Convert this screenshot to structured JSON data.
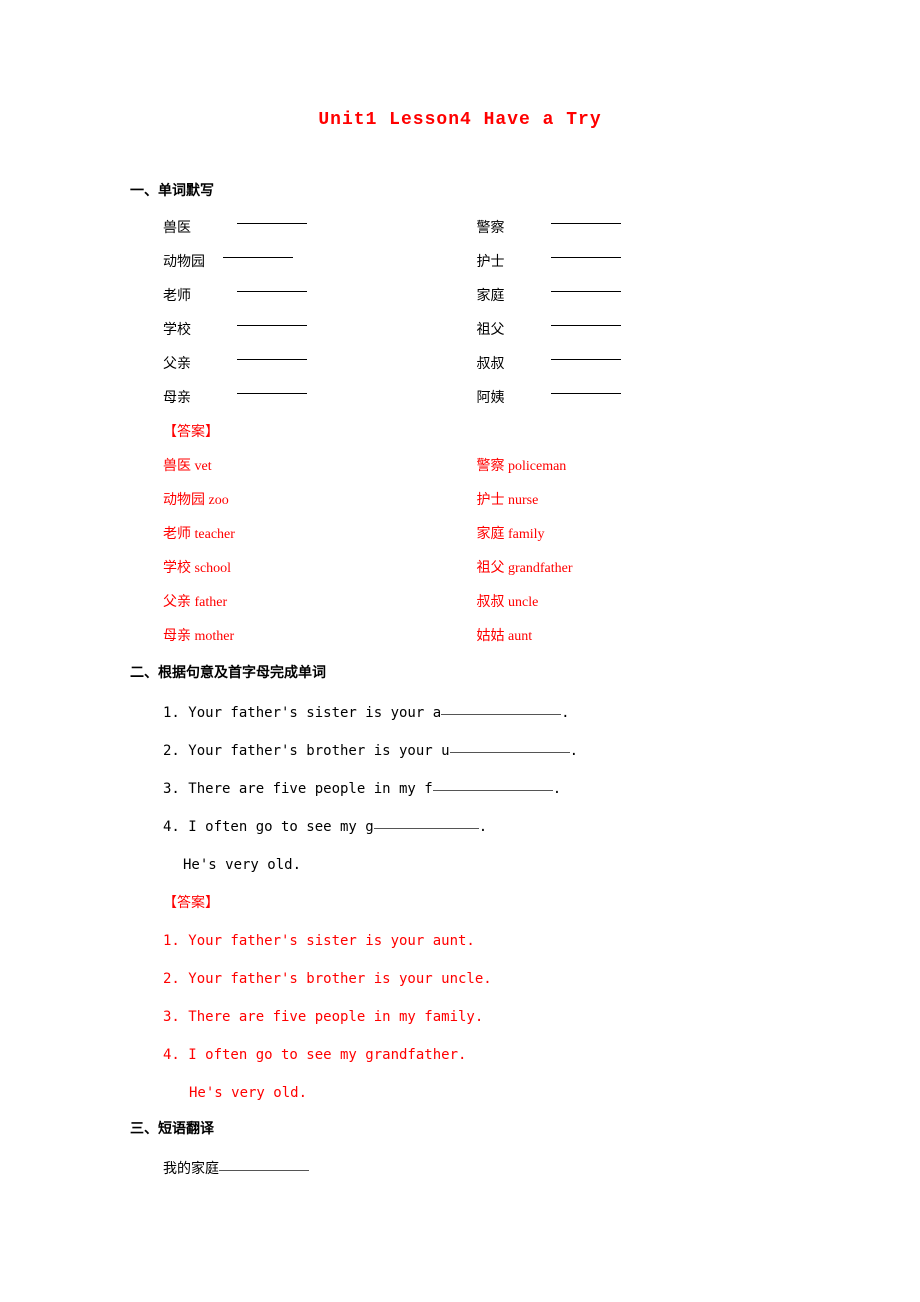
{
  "title": "Unit1 Lesson4 Have a Try",
  "section1": {
    "header": "一、单词默写",
    "left": [
      "兽医",
      "动物园",
      "老师",
      "学校",
      "父亲",
      "母亲"
    ],
    "right": [
      "警察",
      "护士",
      "家庭",
      "祖父",
      "叔叔",
      "阿姨"
    ],
    "answer_label": "【答案】",
    "answers_left": [
      "兽医 vet",
      "动物园 zoo",
      "老师 teacher",
      "学校 school",
      "父亲 father",
      "母亲 mother"
    ],
    "answers_right": [
      "警察 policeman",
      "护士 nurse",
      "家庭 family",
      "祖父 grandfather",
      "叔叔 uncle",
      "姑姑 aunt"
    ]
  },
  "section2": {
    "header": "二、根据句意及首字母完成单词",
    "q1": "1. Your father's sister is your a",
    "q1_tail": ".",
    "q2": "2. Your father's brother is your u",
    "q2_tail": ".",
    "q3": "3. There are five people in my f",
    "q3_tail": ".",
    "q4": "4. I often go to see my g",
    "q4_tail": ".",
    "q4_sub": "He's very old.",
    "answer_label": "【答案】",
    "a1": "1. Your father's sister is your aunt.",
    "a2": "2. Your father's brother is your uncle.",
    "a3": "3. There are five people in my family.",
    "a4": "4. I often go to see my grandfather.",
    "a4_sub": "He's very old."
  },
  "section3": {
    "header": "三、短语翻译",
    "q1": "我的家庭"
  }
}
